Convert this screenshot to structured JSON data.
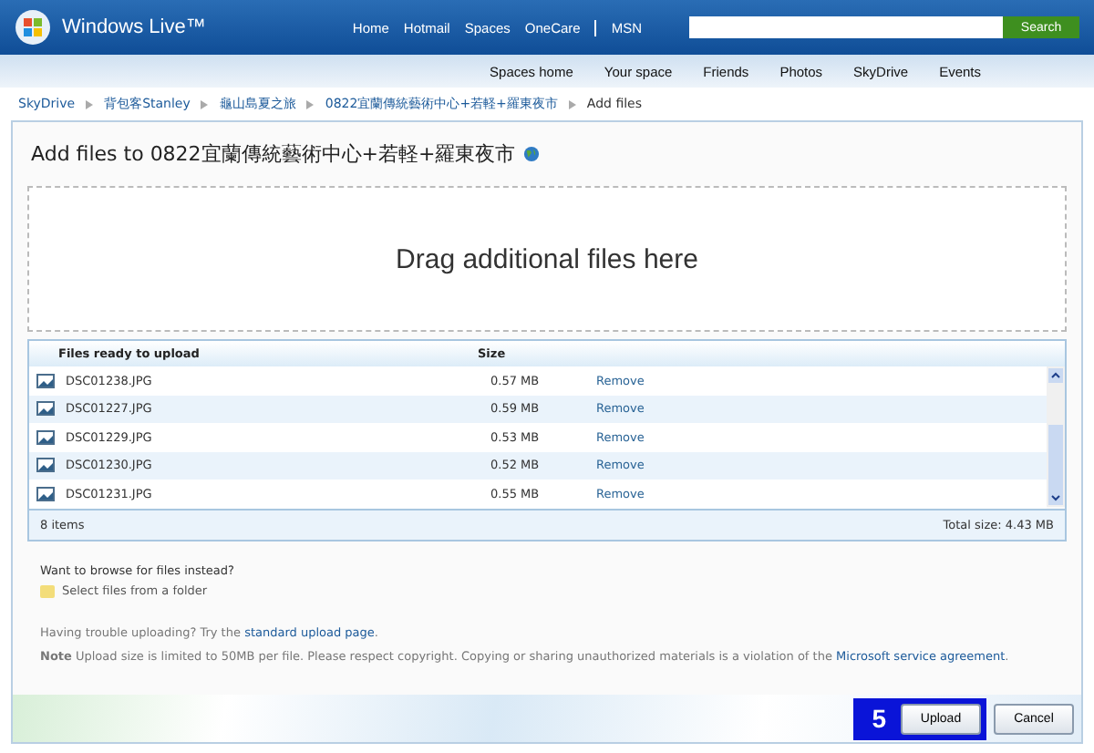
{
  "brand": "Windows Live™",
  "top_nav": [
    "Home",
    "Hotmail",
    "Spaces",
    "OneCare",
    "MSN"
  ],
  "search": {
    "button": "Search"
  },
  "sub_nav": [
    "Spaces home",
    "Your space",
    "Friends",
    "Photos",
    "SkyDrive",
    "Events"
  ],
  "breadcrumbs": [
    "SkyDrive",
    "背包客Stanley",
    "龜山島夏之旅",
    "0822宜蘭傳統藝術中心+若軽+羅東夜市",
    "Add files"
  ],
  "title": "Add files to 0822宜蘭傳統藝術中心+若軽+羅東夜市",
  "drop_zone": "Drag additional files here",
  "table": {
    "columns": [
      "Files ready to upload",
      "Size"
    ],
    "rows": [
      {
        "name": "DSC01238.JPG",
        "size": "0.57 MB",
        "action": "Remove"
      },
      {
        "name": "DSC01227.JPG",
        "size": "0.59 MB",
        "action": "Remove"
      },
      {
        "name": "DSC01229.JPG",
        "size": "0.53 MB",
        "action": "Remove"
      },
      {
        "name": "DSC01230.JPG",
        "size": "0.52 MB",
        "action": "Remove"
      },
      {
        "name": "DSC01231.JPG",
        "size": "0.55 MB",
        "action": "Remove"
      }
    ],
    "count": "8 items",
    "total": "Total size: 4.43 MB"
  },
  "browse": {
    "prompt": "Want to browse for files instead?",
    "link": "Select files from a folder"
  },
  "trouble": {
    "text": "Having trouble uploading? Try the",
    "link": "standard upload page",
    "end": "."
  },
  "note": {
    "text": "**Note** Upload size is limited to 50MB per file. Please respect copyright. Copying or sharing unauthorized materials is a violation of the",
    "link": "Microsoft service agreement",
    "end": "."
  },
  "callout": "5",
  "buttons": [
    "Upload",
    "Cancel"
  ]
}
